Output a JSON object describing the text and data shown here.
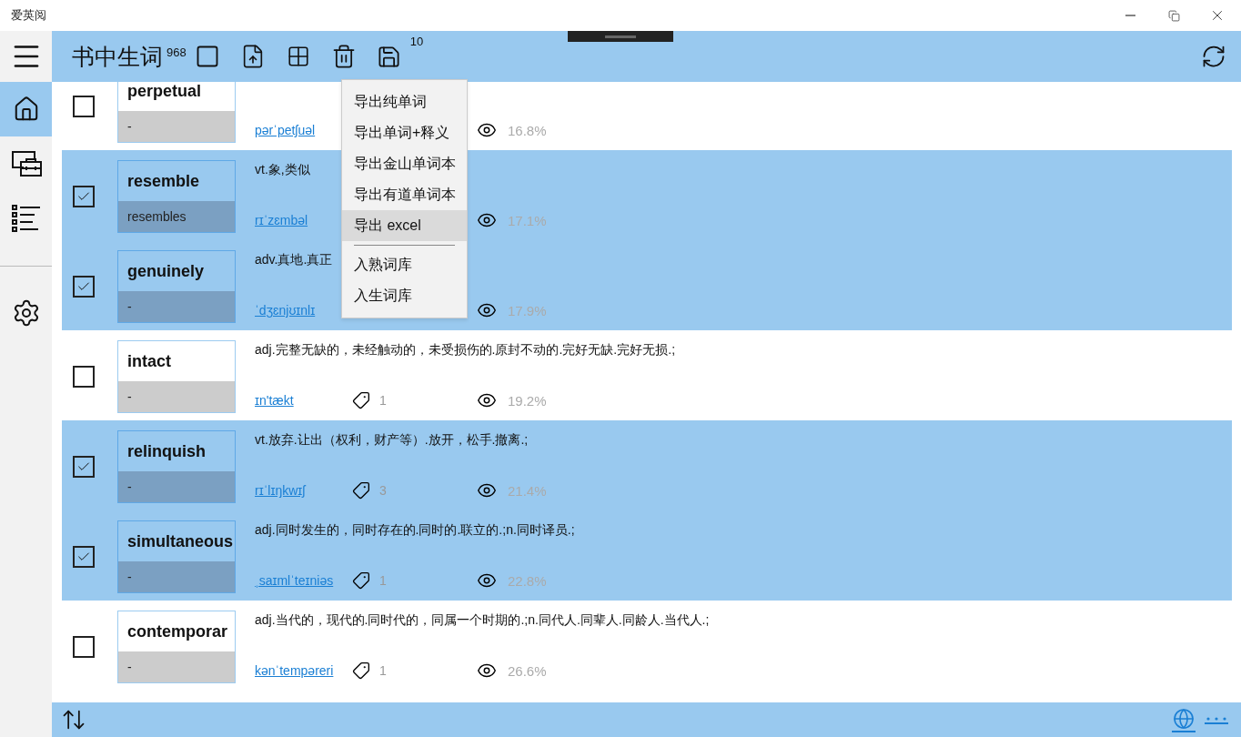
{
  "window": {
    "title": "爱英阅"
  },
  "sidebar": {
    "items": [
      {
        "kind": "home",
        "selected": true
      },
      {
        "kind": "toolbox",
        "selected": false
      },
      {
        "kind": "list",
        "selected": false
      },
      {
        "kind": "settings",
        "selected": false
      }
    ]
  },
  "header": {
    "title": "书中生词",
    "count": "968",
    "selected_count": "10"
  },
  "words": [
    {
      "word": "perpetual",
      "forms": "-",
      "phonetic": "pərˈpetʃuəl",
      "seen": "16.8%",
      "checked": false
    },
    {
      "word": "resemble",
      "forms": "resembles",
      "definition": "vt.象,类似",
      "phonetic": "rɪˈzɛmbəl",
      "seen": "17.1%",
      "checked": true
    },
    {
      "word": "genuinely",
      "forms": "-",
      "definition": "adv.真地.真正",
      "phonetic": "ˈdʒɛnjʊɪnlɪ",
      "seen": "17.9%",
      "checked": true
    },
    {
      "word": "intact",
      "forms": "-",
      "definition": "adj.完整无缺的，未经触动的，未受损伤的.原封不动的.完好无缺.完好无损.;",
      "phonetic": "ɪn'tækt",
      "tags": "1",
      "seen": "19.2%",
      "checked": false
    },
    {
      "word": "relinquish",
      "forms": "-",
      "definition": "vt.放弃.让出（权利，财产等）.放开，松手.撤离.;",
      "phonetic": "rɪˈlɪŋkwɪʃ",
      "tags": "3",
      "seen": "21.4%",
      "checked": true
    },
    {
      "word": "simultaneous",
      "forms": "-",
      "definition": "adj.同时发生的，同时存在的.同时的.联立的.;n.同时译员.;",
      "phonetic": "ˌsaɪmlˈteɪniəs",
      "tags": "1",
      "seen": "22.8%",
      "checked": true
    },
    {
      "word": "contemporar",
      "forms": "-",
      "definition": "adj.当代的，现代的.同时代的，同属一个时期的.;n.同代人.同辈人.同龄人.当代人.;",
      "phonetic": "kənˈtempəreri",
      "tags": "1",
      "seen": "26.6%",
      "checked": false
    }
  ],
  "menu": {
    "items": [
      {
        "kind": "item",
        "label": "导出纯单词",
        "selected": false
      },
      {
        "kind": "item",
        "label": "导出单词+释义",
        "selected": false
      },
      {
        "kind": "item",
        "label": "导出金山单词本",
        "selected": false
      },
      {
        "kind": "item",
        "label": "导出有道单词本",
        "selected": false
      },
      {
        "kind": "item",
        "label": "导出 excel",
        "selected": true
      },
      {
        "kind": "separator"
      },
      {
        "kind": "item",
        "label": "入熟词库",
        "selected": false
      },
      {
        "kind": "item",
        "label": "入生词库",
        "selected": false
      }
    ]
  }
}
